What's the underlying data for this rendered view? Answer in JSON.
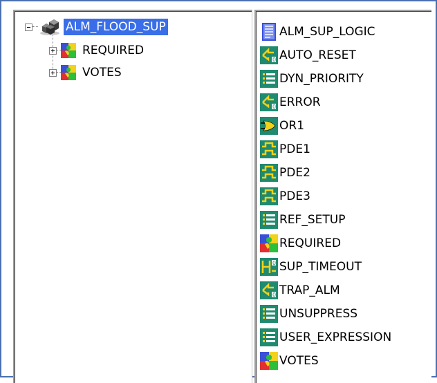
{
  "tree": {
    "root": {
      "label": "ALM_FLOOD_SUP",
      "icon": "module-icon",
      "expanded": true,
      "selected": true
    },
    "children": [
      {
        "label": "REQUIRED",
        "icon": "composite-block-icon",
        "expanded": false
      },
      {
        "label": "VOTES",
        "icon": "composite-block-icon",
        "expanded": false
      }
    ]
  },
  "contents": {
    "items": [
      {
        "label": "ALM_SUP_LOGIC",
        "icon": "logic-sheet-icon"
      },
      {
        "label": "AUTO_RESET",
        "icon": "function-block-icon"
      },
      {
        "label": "DYN_PRIORITY",
        "icon": "parameter-list-icon"
      },
      {
        "label": "ERROR",
        "icon": "function-block-icon"
      },
      {
        "label": "OR1",
        "icon": "or-gate-icon"
      },
      {
        "label": "PDE1",
        "icon": "pulse-detect-icon"
      },
      {
        "label": "PDE2",
        "icon": "pulse-detect-icon"
      },
      {
        "label": "PDE3",
        "icon": "pulse-detect-icon"
      },
      {
        "label": "REF_SETUP",
        "icon": "parameter-list-icon"
      },
      {
        "label": "REQUIRED",
        "icon": "composite-block-icon"
      },
      {
        "label": "SUP_TIMEOUT",
        "icon": "timer-icon"
      },
      {
        "label": "TRAP_ALM",
        "icon": "function-block-icon"
      },
      {
        "label": "UNSUPPRESS",
        "icon": "parameter-list-icon"
      },
      {
        "label": "USER_EXPRESSION",
        "icon": "parameter-list-icon"
      },
      {
        "label": "VOTES",
        "icon": "composite-block-icon"
      }
    ]
  },
  "colors": {
    "frame_border": "#4a6fb0",
    "selection": "#3a6ee8",
    "icon_teal": "#1f8a70",
    "icon_green": "#2bbf3a",
    "icon_yellow": "#f2d21b",
    "icon_red": "#e03030",
    "icon_blue": "#3a4fd8"
  }
}
